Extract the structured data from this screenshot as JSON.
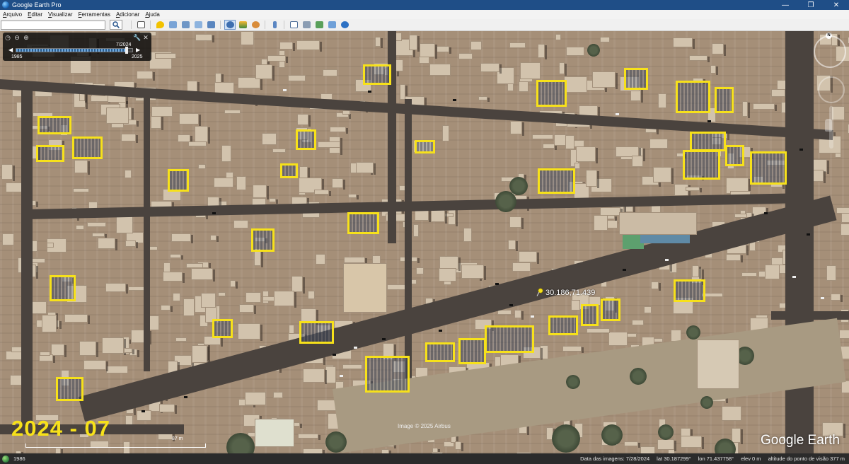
{
  "window": {
    "title": "Google Earth Pro",
    "controls": {
      "minimize": "—",
      "maximize": "❐",
      "close": "✕"
    }
  },
  "menu": [
    "Arquivo",
    "Editar",
    "Visualizar",
    "Ferramentas",
    "Adicionar",
    "Ajuda"
  ],
  "toolbar": {
    "search_value": "",
    "search_placeholder": "",
    "tools": [
      "sidebar-toggle-icon",
      "placemark-icon",
      "polygon-icon",
      "path-icon",
      "image-overlay-icon",
      "record-tour-icon",
      "historical-imagery-icon",
      "sunlight-icon",
      "planets-icon",
      "ruler-icon",
      "email-icon",
      "print-icon",
      "save-image-icon",
      "maps-view-icon",
      "earth-icon"
    ]
  },
  "time_slider": {
    "start_year": "1985",
    "end_year": "2025",
    "current": "7/2024",
    "position": 0.95
  },
  "map": {
    "overlay_date": "2024 - 07",
    "placemark_label": "30.186,71.439",
    "copyright": "Image © 2025 Airbus",
    "logo": "Google Earth",
    "scale_label": "87 m",
    "compass_letter": "N",
    "highlight_color": "#f7e11a"
  },
  "status": {
    "history_year": "1986",
    "imagery_date_label": "Data das imagens: 7/28/2024",
    "lat_label": "lat",
    "lat_value": "30.187299°",
    "lon_label": "lon",
    "lon_value": "71.437758°",
    "elev_label": "elev",
    "elev_value": "0 m",
    "eye_alt_label": "altitude do ponto de visão",
    "eye_alt_value": "377 m"
  }
}
